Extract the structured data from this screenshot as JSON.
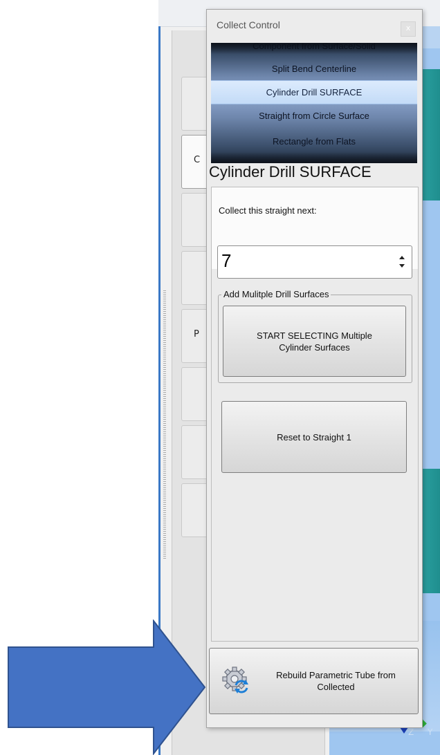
{
  "panel": {
    "title": "Collect Control",
    "close_label": "x",
    "list_items": [
      {
        "label": "Component from Surface/Solid",
        "selected": false
      },
      {
        "label": "Split Bend Centerline",
        "selected": false
      },
      {
        "label": "Cylinder Drill SURFACE",
        "selected": true
      },
      {
        "label": "Straight from Circle Surface",
        "selected": false
      },
      {
        "label": "Rectangle from Flats",
        "selected": false
      }
    ],
    "section_title": "Cylinder Drill SURFACE",
    "collect_label": "Collect this straight next:",
    "straight_number": "7",
    "group_title": "Add Mulitple Drill Surfaces",
    "multi_button_label": "START SELECTING Multiple Cylinder Surfaces",
    "reset_button_label": "Reset to Straight 1",
    "rebuild_button_label": "Rebuild Parametric Tube from Collected"
  },
  "background": {
    "tab_letters": [
      "",
      "C",
      "",
      "",
      "P",
      "",
      "",
      ""
    ],
    "axis_labels": "Z Y"
  },
  "colors": {
    "panel_bg": "#ececec",
    "list_selected": "#c3dbf7",
    "arrow": "#4472c4",
    "viewport": "#9fc6f0",
    "viewport_teal": "#2ba3a3"
  },
  "icons": {
    "rebuild": "gear-refresh-icon",
    "close": "close-icon",
    "spinner": "spin-arrows-icon"
  }
}
